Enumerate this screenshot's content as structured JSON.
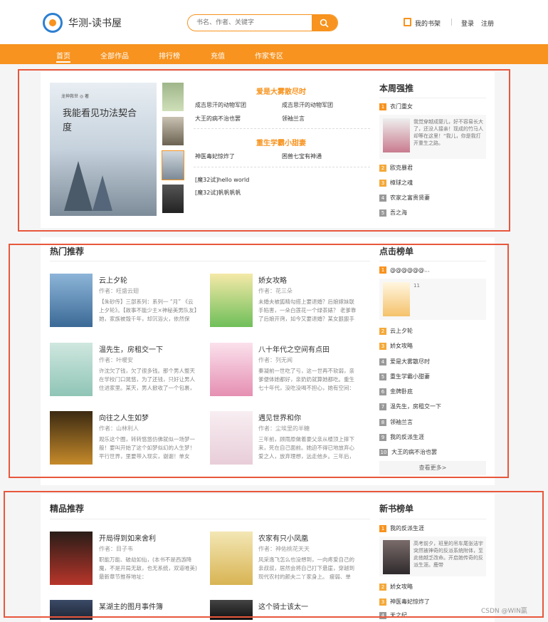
{
  "header": {
    "site_name": "华测-读书屋",
    "search_placeholder": "书名、作者、关键字",
    "shelf": "我的书架",
    "login": "登录",
    "register": "注册"
  },
  "nav": [
    "首页",
    "全部作品",
    "排行榜",
    "充值",
    "作家专区"
  ],
  "banner": {
    "big_cover_author": "龙神救世 ◎ 著",
    "big_cover_title": "我能看见功法契合度",
    "head1": "爱是大雾散尽时",
    "links1": [
      "成吉思汗的动物军团",
      "成吉思汗的动物军团",
      "大王的病不治也罢",
      "领袖兰言"
    ],
    "head2": "重生学霸小甜妻",
    "links2": [
      "神医毒妃惊炸了",
      "困兽七宝有神通"
    ],
    "links3": [
      "[魔32试]hello world",
      "[魔32试]帆帆帆帆"
    ]
  },
  "weekly": {
    "title": "本周强推",
    "items": [
      "衣门重女",
      "欧克暴君",
      "樟球之魂",
      "农家之富贵贤妻",
      "吾之海"
    ],
    "feature_desc": "我觉穿越成婴儿，好不容易长大了，还没人接亲！现成的竹马人却等在这里！“我儿，你是我打开重生之路。"
  },
  "hot": {
    "title": "热门推荐",
    "books": [
      {
        "title": "云上夕轮",
        "author": "作者：旺盛云翅",
        "desc": "【朱砂传】三部系列：系列一 “月” 《云上夕轮》。【故事不能少主×神秘美男队友】她，家族被毁千年，却沉浴火，依然保"
      },
      {
        "title": "娇女攻略",
        "author": "作者：花三朵",
        "desc": "未婚夫被狐精勾搭上要退婚？后娘嫁妹联手陷害，一朵白莲花一个绿茶婊？ 老爹靠了后娘开窍，如今又要退婚？某女狠狠手指："
      },
      {
        "title": "温先生，房租交一下",
        "author": "作者：叶暖安",
        "desc": "许沈欠了钱，欠了很多钱。那个男人整天在学校门口晃悠，为了还钱，只好让男人住进家里。某天，男人掀收了一个包裹，许沈"
      },
      {
        "title": "八十年代之空间有点田",
        "author": "作者：列无闻",
        "desc": "秦凝前一世吃了亏，这一世再不软弱，亲爹便体她都好，亲奶奶就算她都吃。重生七十年代，没吃没喝不担心，她有空间："
      },
      {
        "title": "向往之人生如梦",
        "author": "作者：山林利人",
        "desc": "观乐这个圈，转转悠悠仿佛就似一场梦一般！要叫开始了这个如梦似幻的人生梦！平行世界，里要带入现实，谢谢！单女主，"
      },
      {
        "title": "遇见世界和你",
        "author": "作者：尘埃里的半糖",
        "desc": "三年前，顾雨原做着豪父亲从楼顶上摔下来，死在自己面前。她迫不得已地放弃心爱之人，放弃理想，远走他乡。三年后，她回"
      }
    ]
  },
  "click_rank": {
    "title": "点击榜单",
    "items": [
      "@@@@@@...",
      "云上夕轮",
      "娇女攻略",
      "爱是大雾散尽时",
      "重生学霸小甜妻",
      "金牌卧底",
      "温先生，房租交一下",
      "领袖兰言",
      "我的反派生涯",
      "大王的病不治也罢"
    ],
    "feature_num": "11",
    "more": "查看更多>"
  },
  "featured": {
    "title": "精品推荐",
    "books": [
      {
        "title": "开局得到如来舍利",
        "author": "作者：目子韦",
        "desc": "职能万能、破劫如仙，(本书不是西游降魔，不是开局无敌，也无系统，双道唯美) 最新章节推荐地址："
      },
      {
        "title": "农家有只小凤凰",
        "author": "作者：神佑桃花天天",
        "desc": "风采逸飞怎么也没想到，一向疼爱自己的亲叔叔，居然会将自己打下悬崖，穿越到现代农村的颜夫二丫家身上。 瘦弱、单薄、这样的"
      },
      {
        "title": "某湖主的图月事件簿",
        "author": "",
        "desc": ""
      },
      {
        "title": "这个骑士该太一",
        "author": "",
        "desc": ""
      }
    ]
  },
  "new_rank": {
    "title": "新书榜单",
    "items": [
      "我的反派生涯",
      "娇女攻略",
      "神医毒妃惊炸了",
      "天之纪"
    ],
    "feature_desc": "高考前夕，班里的吊车尾张洁宇突然被神奇的反派系统附体，至此他越乏改命。开启她传奇的反派生涯。鹿带"
  },
  "watermark": "CSDN @WIN赢",
  "colors": {
    "accent": "#f7931e",
    "highlight_box": "#e8573c"
  }
}
